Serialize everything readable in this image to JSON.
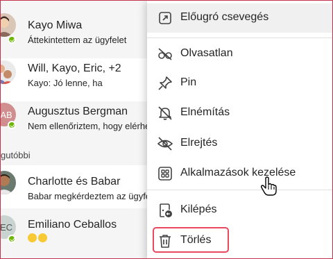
{
  "chats": [
    {
      "name": "Kayo Miwa",
      "preview": "Áttekintettem az ügyfelet"
    },
    {
      "name": "Will, Kayo, Eric, +2",
      "preview": "Kayo: Jó lenne, ha"
    },
    {
      "name": "Augusztus Bergman",
      "preview": "Nem ellenőriztem, hogy elérhető-e",
      "initials": "AB"
    },
    {
      "name": "Charlotte és Babar",
      "preview": "Babar megkérdeztem az ügyfelet"
    },
    {
      "name": "Emiliano Ceballos",
      "preview": "",
      "initials": "EC"
    }
  ],
  "section_label": "gutóbbi",
  "menu": {
    "popout": "Előugró csevegés",
    "unread": "Olvasatlan",
    "pin": "Pin",
    "mute": "Elnémítás",
    "hide": "Elrejtés",
    "manage_apps": "Alkalmazások kezelése",
    "leave": "Kilépés",
    "delete": "Törlés"
  },
  "colors": {
    "presence_available": "#6bb700",
    "highlight_border": "#e8475e",
    "frame_border": "#c4314b"
  }
}
